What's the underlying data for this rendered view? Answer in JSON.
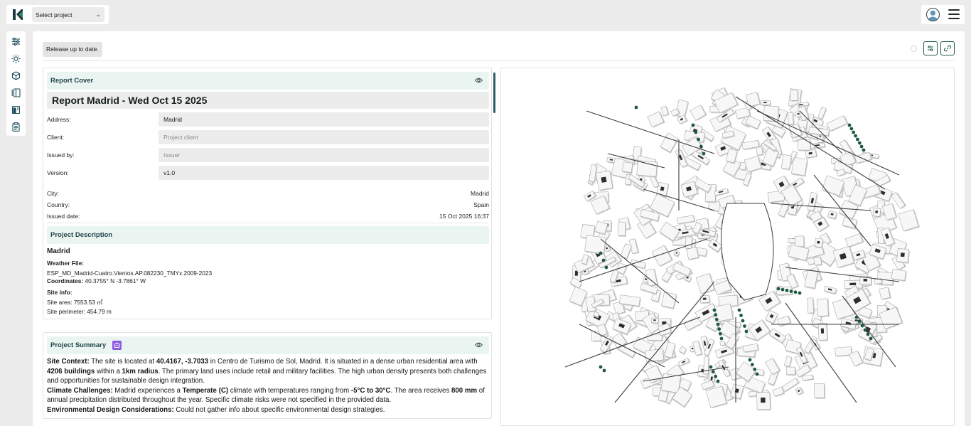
{
  "header": {
    "project_select": {
      "label": "Select project"
    }
  },
  "icons": {
    "logo": "brand-logo",
    "sidebar": [
      "sliders-icon",
      "sun-icon",
      "cube-icon",
      "layers-icon",
      "building-icon",
      "clipboard-icon"
    ],
    "toolbar": [
      "spinner-icon",
      "filter-settings-icon",
      "link-icon"
    ],
    "header": [
      "avatar-icon",
      "hamburger-menu-icon"
    ]
  },
  "colors": {
    "accent": "#1f5c4a",
    "section_bg": "#eaf5f2",
    "ai_badge": "#8d5be3",
    "tree": "#1f5a3d"
  },
  "status": {
    "label": "Release up to date."
  },
  "report_cover": {
    "section_title": "Report Cover",
    "report_title": "Report Madrid - Wed Oct 15 2025",
    "fields": {
      "address": {
        "label": "Address:",
        "value": "Madrid"
      },
      "client": {
        "label": "Client:",
        "placeholder": "Project client"
      },
      "issued_by": {
        "label": "Issued by:",
        "placeholder": "Issuer"
      },
      "version": {
        "label": "Version:",
        "value": "v1.0"
      }
    },
    "info": [
      {
        "label": "City:",
        "value": "Madrid"
      },
      {
        "label": "Country:",
        "value": "Spain"
      },
      {
        "label": "Issued date:",
        "value": "15 Oct 2025 16:37"
      }
    ]
  },
  "project_description": {
    "section_title": "Project Description",
    "name": "Madrid",
    "weather_label": "Weather File:",
    "weather_file": "ESP_MD_Madrid-Cuatro.Vientos.AP.082230_TMYx.2009-2023",
    "coordinates_label": "Coordinates:",
    "coordinates": "40.3755° N -3.7861° W",
    "site_info_label": "Site info:",
    "site_area": "Site area: 7553.53 ㎡",
    "site_perimeter": "Site perimeter: 454.79 m"
  },
  "project_summary": {
    "section_title": "Project Summary",
    "site_context_label": "Site Context:",
    "sc_1": " The site is located at ",
    "sc_coords": "40.4167, -3.7033",
    "sc_2": " in Centro de Turismo de Sol, Madrid. It is situated in a dense urban residential area with ",
    "sc_buildings": "4206 buildings",
    "sc_3": " within a ",
    "sc_radius": "1km radius",
    "sc_4": ". The primary land uses include retail and military facilities. The high urban density presents both challenges and opportunities for sustainable design integration.",
    "climate_label": "Climate Challenges:",
    "cc_1": " Madrid experiences a ",
    "cc_climate": "Temperate (C)",
    "cc_2": " climate with temperatures ranging from ",
    "cc_range": "-5°C to 30°C",
    "cc_3": ". The area receives ",
    "cc_precip": "800 mm",
    "cc_4": " of annual precipitation distributed throughout the year. Specific climate risks were not specified in the provided data.",
    "env_label": "Environmental Design Considerations:",
    "env_text": " Could not gather info about specific environmental design strategies."
  }
}
